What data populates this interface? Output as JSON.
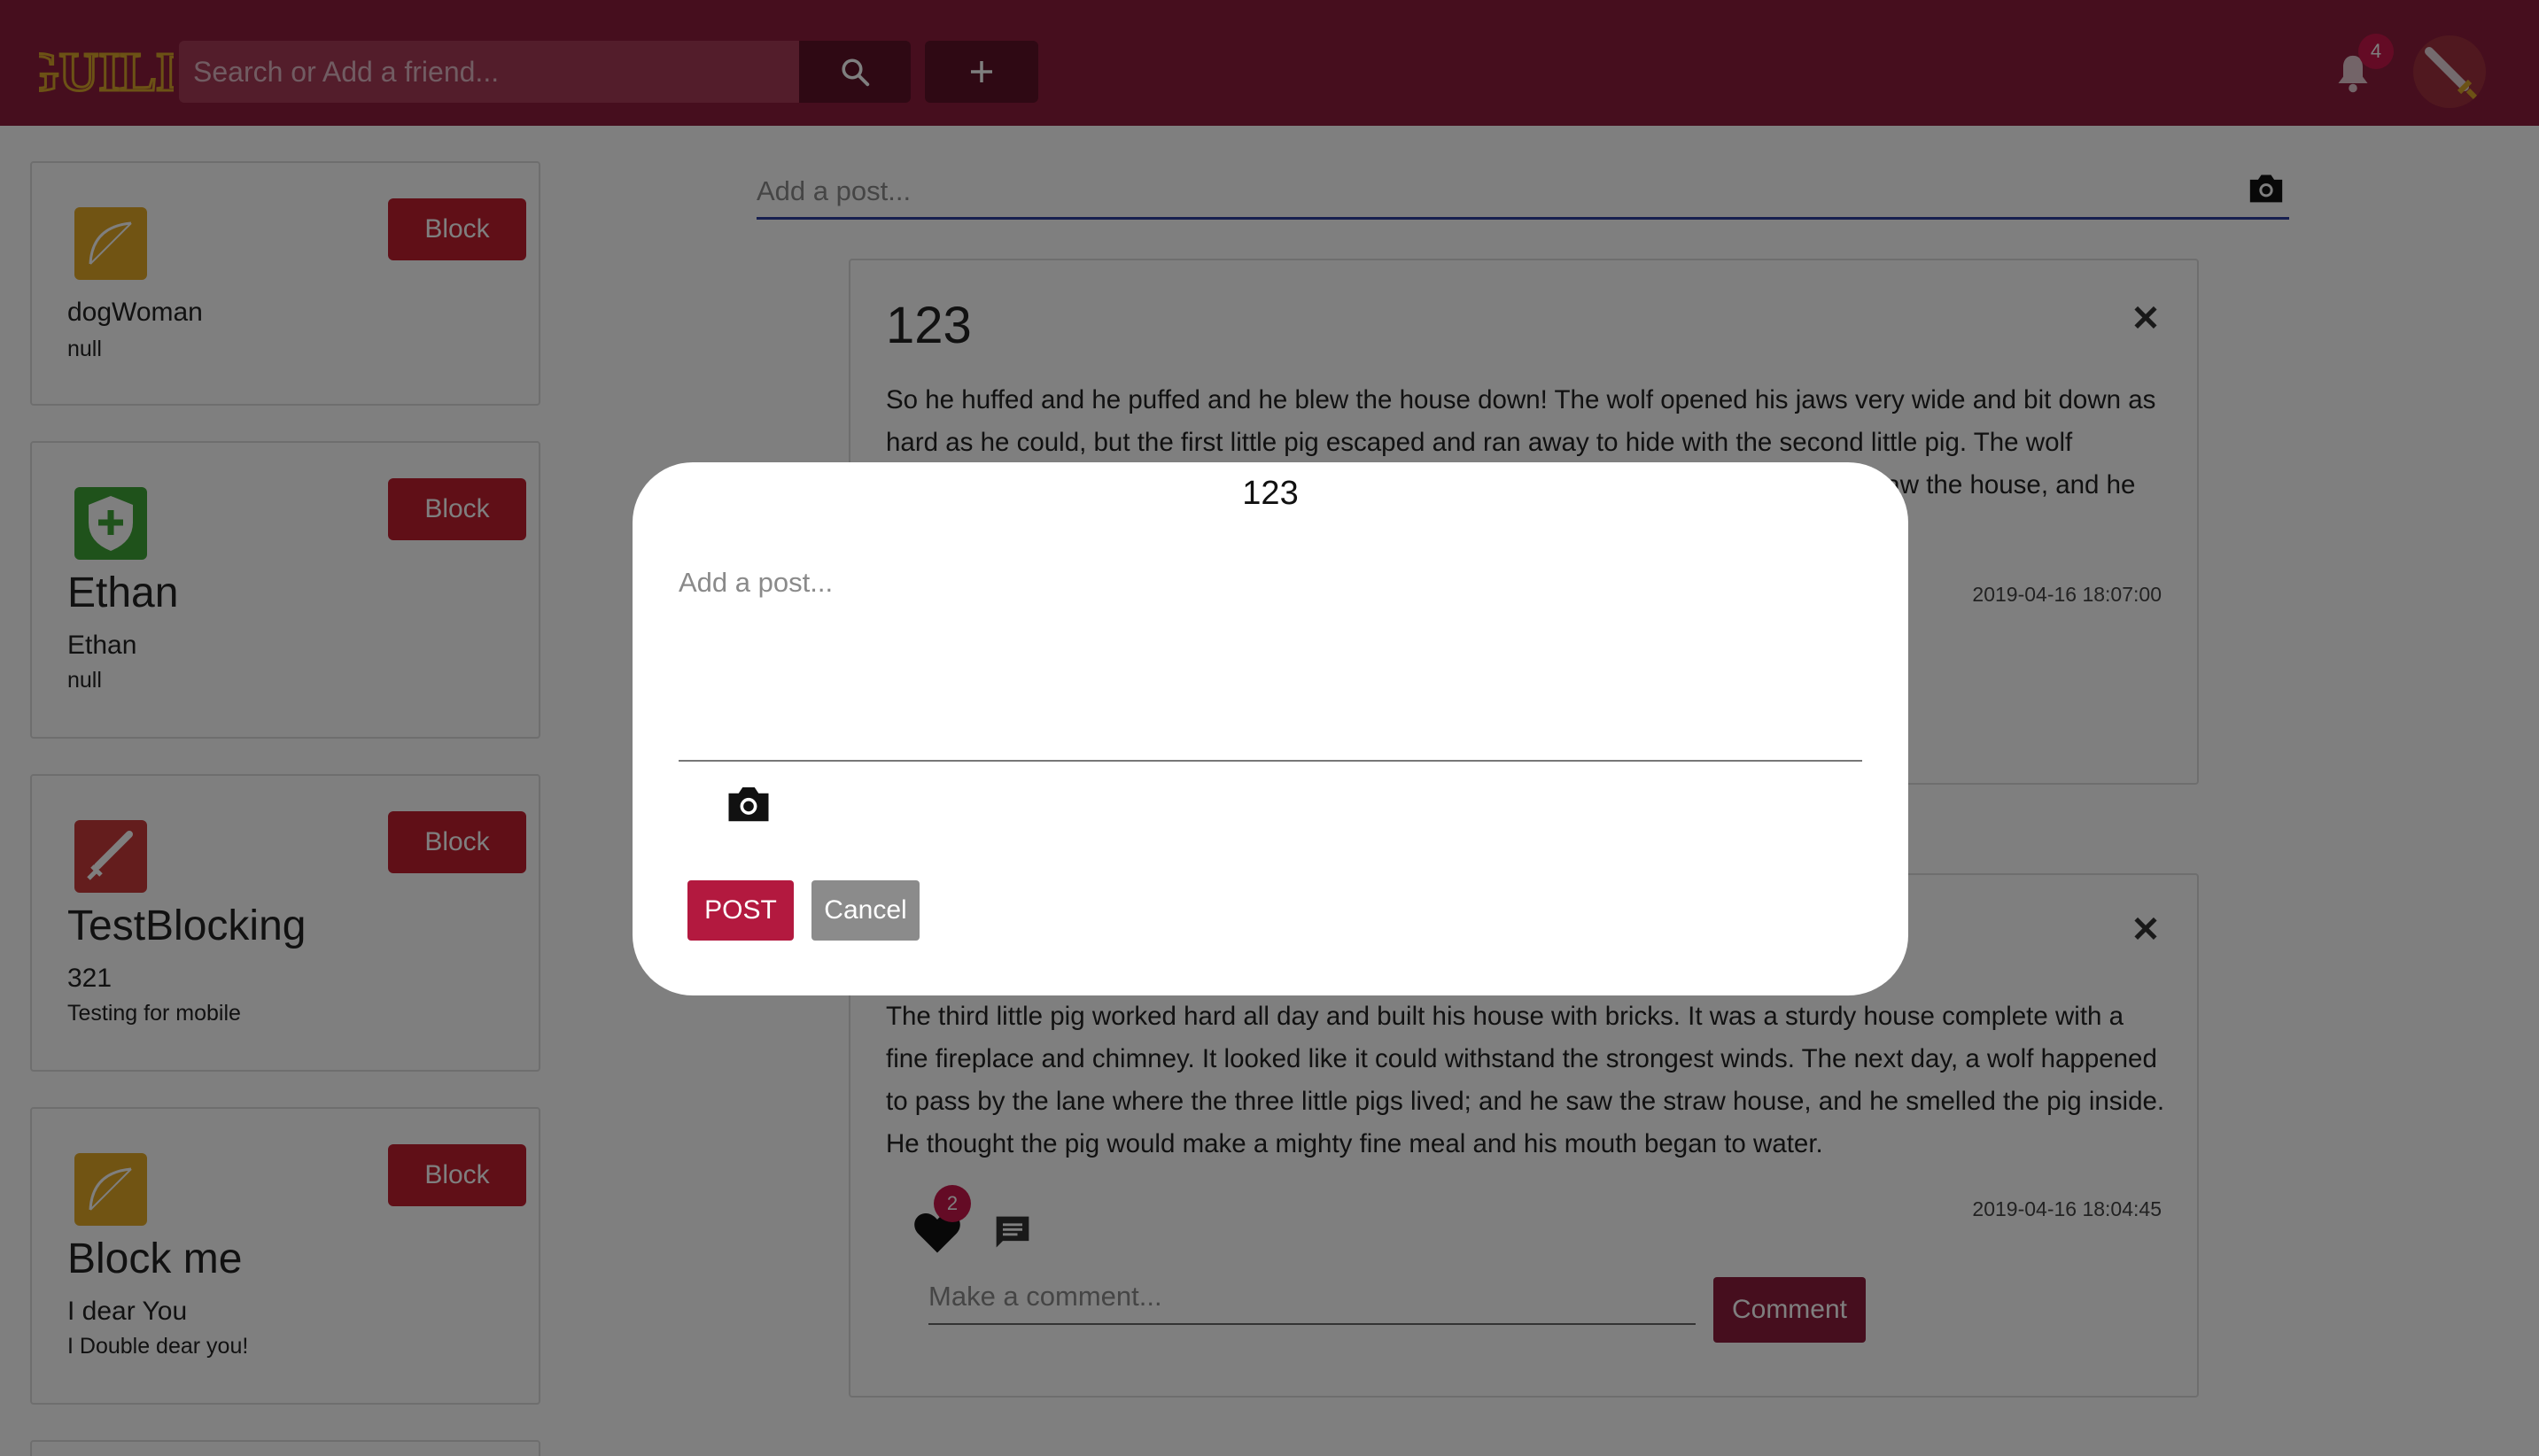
{
  "header": {
    "logo_text": "GUILD",
    "search_placeholder": "Search or Add a friend...",
    "search_icon": "search-icon",
    "add_icon": "plus-icon",
    "notifications_icon": "bell-icon",
    "notifications_count": "4",
    "colors": {
      "bar": "#8c1c3c",
      "buttons": "#5f1228",
      "badge": "#c8174a"
    }
  },
  "friends": [
    {
      "icon": "bow-icon",
      "icon_color": "#e3a826",
      "big": "",
      "name": "dogWoman",
      "sub": "null",
      "block_label": "Block"
    },
    {
      "icon": "shield-plus-icon",
      "icon_color": "#3fa437",
      "big": "Ethan",
      "name": "Ethan",
      "sub": "null",
      "block_label": "Block"
    },
    {
      "icon": "sword-icon",
      "icon_color": "#c93b3b",
      "big": "TestBlocking",
      "name": "321",
      "sub": "Testing for mobile",
      "block_label": "Block"
    },
    {
      "icon": "bow-icon",
      "icon_color": "#e3a826",
      "big": "Block me",
      "name": "I dear You",
      "sub": "I Double dear you!",
      "block_label": "Block"
    }
  ],
  "feed": {
    "new_post_placeholder": "Add a post...",
    "posts": [
      {
        "title": "123",
        "body": "So he huffed and he puffed and he blew the house down! The wolf opened his jaws very wide and bit down as hard as he could, but the first little pig escaped and ran away to hide with the second little pig. The wolf continued down the lane and he passed by the second house made of sticks; and he saw the house, and he smelled the pigs",
        "date": "2019-04-16 18:07:00"
      },
      {
        "title": "",
        "body": "The third little pig worked hard all day and built his house with bricks. It was a sturdy house complete with a fine fireplace and chimney. It looked like it could withstand the strongest winds. The next day, a wolf happened to pass by the lane where the three little pigs lived; and he saw the straw house, and he smelled the pig inside. He thought the pig would make a mighty fine meal and his mouth began to water.",
        "date": "2019-04-16 18:04:45",
        "likes": "2",
        "comment_placeholder": "Make a comment...",
        "comment_label": "Comment"
      }
    ]
  },
  "modal": {
    "title": "123",
    "placeholder": "Add a post...",
    "post_label": "POST",
    "cancel_label": "Cancel",
    "colors": {
      "post": "#b3193f",
      "cancel": "#8b8b8b"
    }
  }
}
